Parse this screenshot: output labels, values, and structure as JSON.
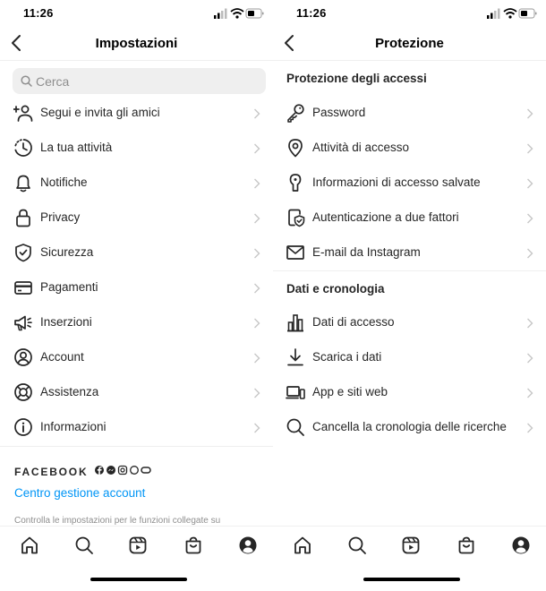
{
  "status": {
    "time": "11:26"
  },
  "left": {
    "title": "Impostazioni",
    "search": {
      "placeholder": "Cerca",
      "value": ""
    },
    "items": [
      {
        "label": "Segui e invita gli amici",
        "icon": "add-person-icon"
      },
      {
        "label": "La tua attività",
        "icon": "activity-clock-icon"
      },
      {
        "label": "Notifiche",
        "icon": "bell-icon"
      },
      {
        "label": "Privacy",
        "icon": "lock-icon"
      },
      {
        "label": "Sicurezza",
        "icon": "shield-check-icon"
      },
      {
        "label": "Pagamenti",
        "icon": "credit-card-icon"
      },
      {
        "label": "Inserzioni",
        "icon": "megaphone-icon"
      },
      {
        "label": "Account",
        "icon": "account-circle-icon"
      },
      {
        "label": "Assistenza",
        "icon": "lifebuoy-icon"
      },
      {
        "label": "Informazioni",
        "icon": "info-icon"
      }
    ],
    "facebook": {
      "brand": "FACEBOOK",
      "link": "Centro gestione account",
      "footer": "Controlla le impostazioni per le funzioni collegate su"
    }
  },
  "right": {
    "title": "Protezione",
    "sections": [
      {
        "title": "Protezione degli accessi",
        "items": [
          {
            "label": "Password",
            "icon": "key-icon"
          },
          {
            "label": "Attività di accesso",
            "icon": "location-pin-icon"
          },
          {
            "label": "Informazioni di accesso salvate",
            "icon": "keyhole-icon"
          },
          {
            "label": "Autenticazione a due fattori",
            "icon": "phone-shield-icon"
          },
          {
            "label": "E-mail da Instagram",
            "icon": "envelope-icon"
          }
        ]
      },
      {
        "title": "Dati e cronologia",
        "items": [
          {
            "label": "Dati di accesso",
            "icon": "bar-chart-icon"
          },
          {
            "label": "Scarica i dati",
            "icon": "download-icon"
          },
          {
            "label": "App e siti web",
            "icon": "devices-icon"
          },
          {
            "label": "Cancella la cronologia delle ricerche",
            "icon": "search-icon"
          }
        ]
      }
    ]
  },
  "tabbar": [
    "home-icon",
    "search-icon",
    "reels-icon",
    "shop-bag-icon",
    "profile-icon"
  ]
}
